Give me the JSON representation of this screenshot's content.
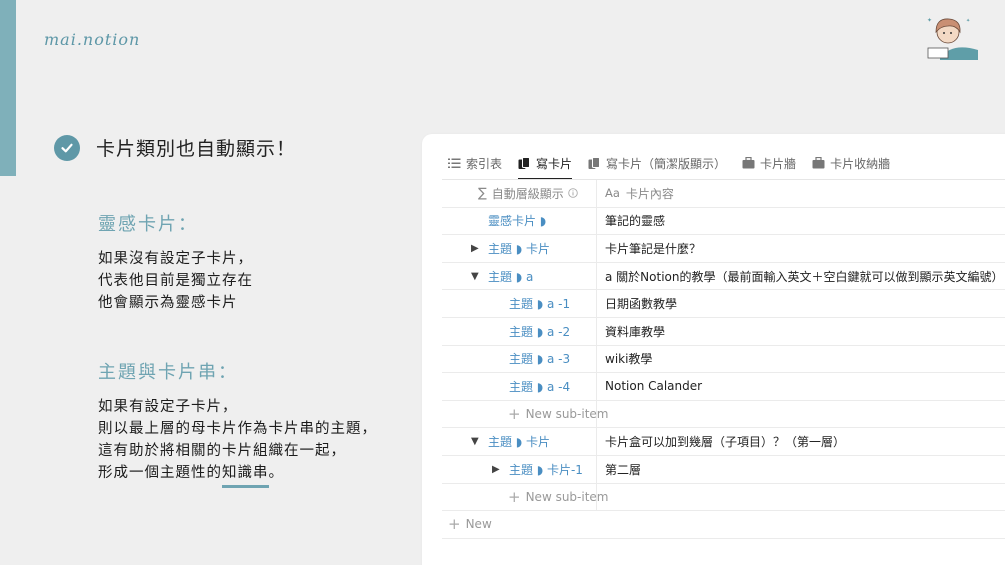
{
  "brand": "mai.notion",
  "headline": "卡片類別也自動顯示！",
  "inspiration": {
    "title": "靈感卡片：",
    "lines": [
      "如果沒有設定子卡片，",
      "代表他目前是獨立存在",
      "他會顯示為靈感卡片"
    ]
  },
  "topic": {
    "title": "主題與卡片串：",
    "lines": [
      "如果有設定子卡片，",
      "則以最上層的母卡片作為卡片串的主題，",
      "這有助於將相關的卡片組織在一起，"
    ],
    "last_line_prefix": "形成一個主題性的",
    "last_line_highlight": "知識串",
    "last_line_suffix": "。"
  },
  "tabs": [
    {
      "label": "索引表",
      "icon": "list-icon"
    },
    {
      "label": "寫卡片",
      "icon": "cards-icon"
    },
    {
      "label": "寫卡片（簡潔版顯示）",
      "icon": "cards-icon"
    },
    {
      "label": "卡片牆",
      "icon": "box-icon"
    },
    {
      "label": "卡片收納牆",
      "icon": "box-icon"
    }
  ],
  "active_tab": "寫卡片",
  "table": {
    "col1_header": "自動層級顯示",
    "col2_prefix": "Aa",
    "col2_header": "卡片內容",
    "rows": [
      {
        "label": "靈感卡片 ◗",
        "content": "筆記的靈感"
      },
      {
        "toggle": "▶",
        "label": "主題 ◗ 卡片",
        "content": "卡片筆記是什麼？"
      },
      {
        "toggle": "▼",
        "label": "主題 ◗ a",
        "content": "a 關於Notion的教學（最前面輸入英文＋空白鍵就可以做到顯示英文編號）"
      },
      {
        "label": "主題 ◗ a -1",
        "content": "日期函數教學"
      },
      {
        "label": "主題 ◗ a -2",
        "content": "資料庫教學"
      },
      {
        "label": "主題 ◗ a -3",
        "content": "wiki教學"
      },
      {
        "label": "主題 ◗ a -4",
        "content": "Notion Calander"
      },
      {
        "sub_item": "New sub-item"
      },
      {
        "toggle": "▼",
        "label": "主題 ◗ 卡片",
        "content": "卡片盒可以加到幾層（子項目）？（第一層）"
      },
      {
        "toggle": "▶",
        "label": "主題 ◗ 卡片-1",
        "content": "第二層"
      },
      {
        "sub_item": "New sub-item"
      }
    ],
    "new_label": "New"
  }
}
